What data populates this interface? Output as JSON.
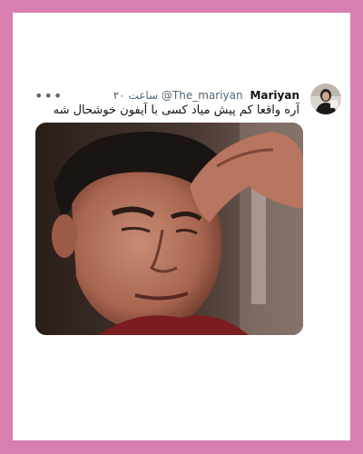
{
  "tweet": {
    "display_name": "Mariyan",
    "handle": "@The_mariyan",
    "time": "۲۰ ساعت",
    "text": "آره واقعا کم پیش میاد کسی با آیفون خوشحال شه",
    "more_label": "•••"
  },
  "colors": {
    "frame": "#d77fb0",
    "card": "#ffffff",
    "name": "#0f1419",
    "meta": "#536471"
  },
  "icons": {
    "more": "more-horizontal-icon"
  }
}
